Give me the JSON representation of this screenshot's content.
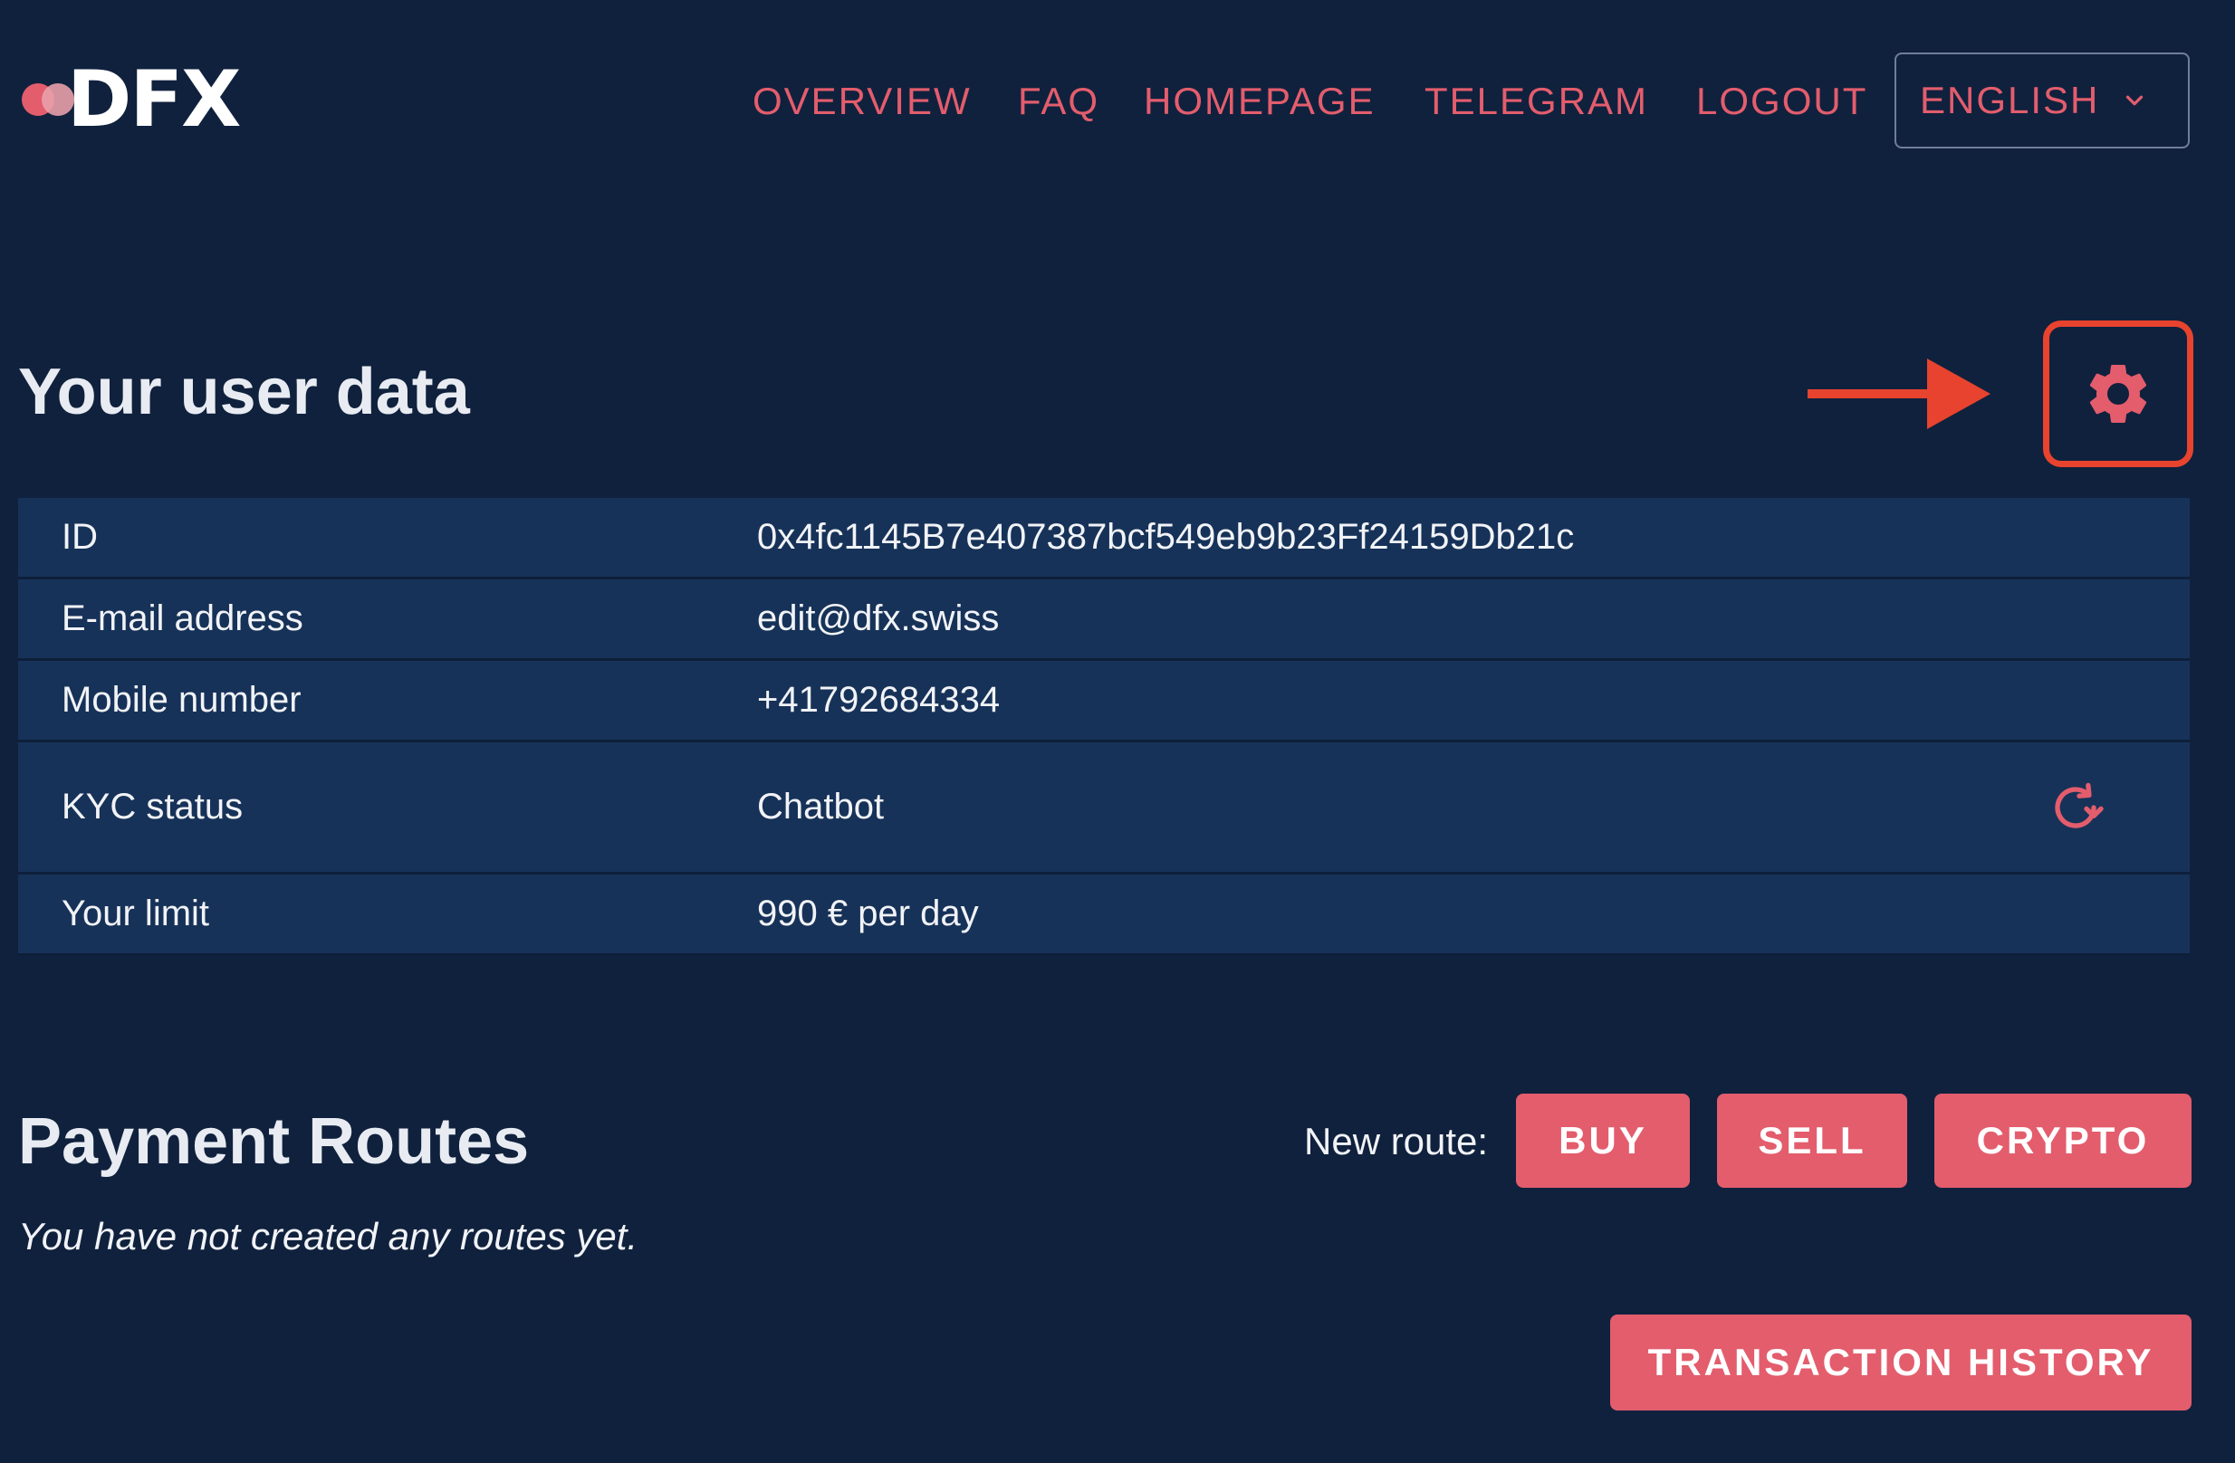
{
  "header": {
    "logo_text": "DFX",
    "nav": [
      {
        "label": "OVERVIEW"
      },
      {
        "label": "FAQ"
      },
      {
        "label": "HOMEPAGE"
      },
      {
        "label": "TELEGRAM"
      },
      {
        "label": "LOGOUT"
      }
    ],
    "language": {
      "selected": "ENGLISH",
      "icon": "chevron-down-icon"
    }
  },
  "user_data": {
    "title": "Your user data",
    "settings_icon": "gear-icon",
    "rows": [
      {
        "label": "ID",
        "value": "0x4fc1145B7e407387bcf549eb9b23Ff24159Db21c"
      },
      {
        "label": "E-mail address",
        "value": "edit@dfx.swiss"
      },
      {
        "label": "Mobile number",
        "value": "+41792684334"
      },
      {
        "label": "KYC status",
        "value": "Chatbot",
        "icon": "refresh-icon"
      },
      {
        "label": "Your limit",
        "value": "990 € per day"
      }
    ]
  },
  "payment_routes": {
    "title": "Payment Routes",
    "new_route_label": "New route:",
    "buttons": {
      "buy": "BUY",
      "sell": "SELL",
      "crypto": "CRYPTO"
    },
    "empty_message": "You have not created any routes yet.",
    "history_button": "TRANSACTION HISTORY"
  },
  "colors": {
    "background": "#10213d",
    "table_row": "#173258",
    "accent": "#e35d6d",
    "annotation": "#e8432e",
    "text": "#e8ecf2"
  }
}
